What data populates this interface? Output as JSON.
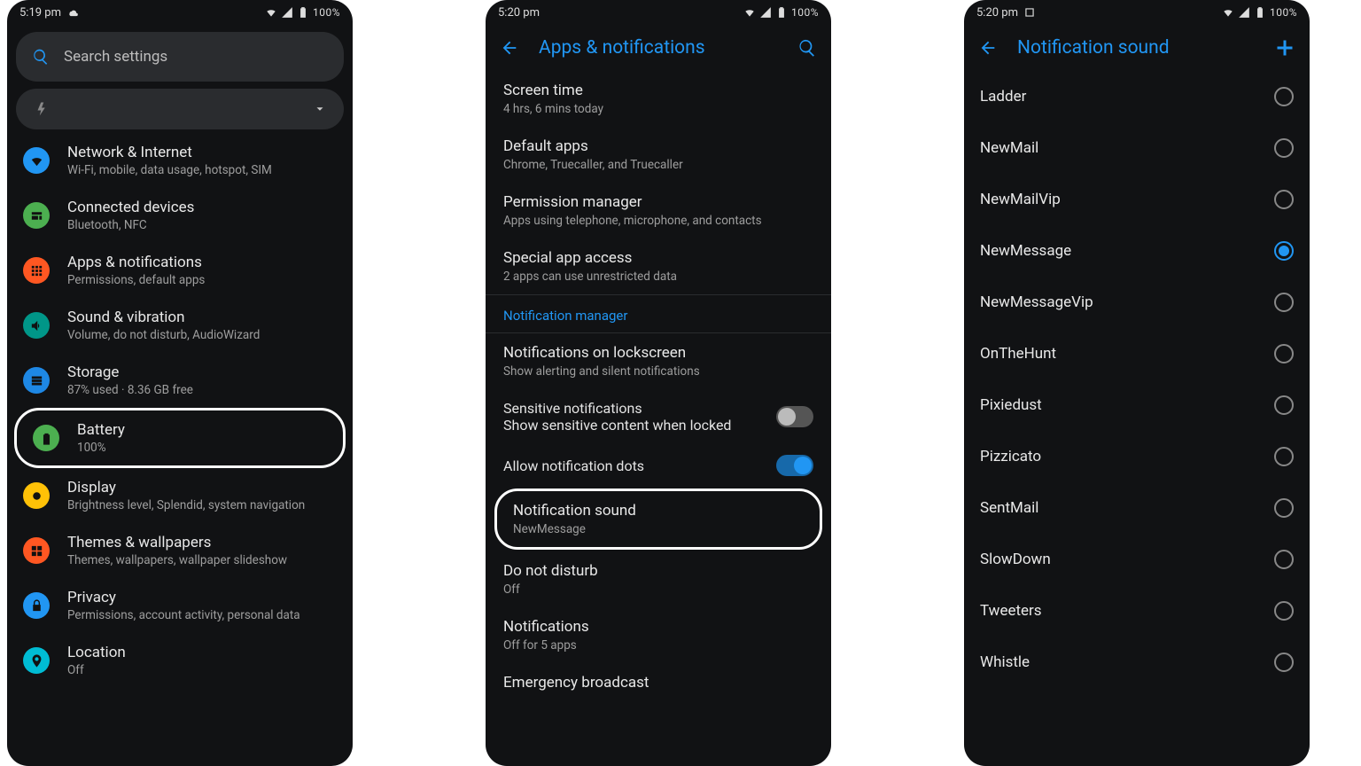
{
  "phone1": {
    "status_time": "5:19 pm",
    "battery_pct": "100%",
    "search_placeholder": "Search settings",
    "items": [
      {
        "title": "Network & Internet",
        "sub": "Wi-Fi, mobile, data usage, hotspot, SIM",
        "color": "#2196f3",
        "icon": "wifi"
      },
      {
        "title": "Connected devices",
        "sub": "Bluetooth, NFC",
        "color": "#4caf50",
        "icon": "devices"
      },
      {
        "title": "Apps & notifications",
        "sub": "Permissions, default apps",
        "color": "#ff5722",
        "icon": "apps"
      },
      {
        "title": "Sound & vibration",
        "sub": "Volume, do not disturb, AudioWizard",
        "color": "#009688",
        "icon": "volume"
      },
      {
        "title": "Storage",
        "sub": "87% used · 8.36 GB free",
        "color": "#1e88e5",
        "icon": "storage"
      },
      {
        "title": "Battery",
        "sub": "100%",
        "color": "#4caf50",
        "icon": "battery",
        "highlighted": true
      },
      {
        "title": "Display",
        "sub": "Brightness level, Splendid, system navigation",
        "color": "#ffc107",
        "icon": "display"
      },
      {
        "title": "Themes & wallpapers",
        "sub": "Themes, wallpapers, wallpaper slideshow",
        "color": "#ff5722",
        "icon": "themes"
      },
      {
        "title": "Privacy",
        "sub": "Permissions, account activity, personal data",
        "color": "#2196f3",
        "icon": "privacy"
      },
      {
        "title": "Location",
        "sub": "Off",
        "color": "#00bcd4",
        "icon": "location"
      }
    ]
  },
  "phone2": {
    "status_time": "5:20 pm",
    "battery_pct": "100%",
    "header_title": "Apps & notifications",
    "items": [
      {
        "title": "Screen time",
        "sub": "4 hrs, 6 mins today"
      },
      {
        "title": "Default apps",
        "sub": "Chrome, Truecaller, and Truecaller"
      },
      {
        "title": "Permission manager",
        "sub": "Apps using telephone, microphone, and contacts"
      },
      {
        "title": "Special app access",
        "sub": "2 apps can use unrestricted data"
      }
    ],
    "section_link": "Notification manager",
    "lockscreen": {
      "title": "Notifications on lockscreen",
      "sub": "Show alerting and silent notifications"
    },
    "sensitive": {
      "title": "Sensitive notifications",
      "sub": "Show sensitive content when locked"
    },
    "dots": {
      "title": "Allow notification dots"
    },
    "notif_sound": {
      "title": "Notification sound",
      "sub": "NewMessage"
    },
    "dnd": {
      "title": "Do not disturb",
      "sub": "Off"
    },
    "notifs": {
      "title": "Notifications",
      "sub": "Off for 5 apps"
    },
    "emergency": {
      "title": "Emergency broadcast"
    }
  },
  "phone3": {
    "status_time": "5:20 pm",
    "battery_pct": "100%",
    "header_title": "Notification sound",
    "sounds": [
      {
        "name": "Ladder",
        "selected": false
      },
      {
        "name": "NewMail",
        "selected": false
      },
      {
        "name": "NewMailVip",
        "selected": false
      },
      {
        "name": "NewMessage",
        "selected": true
      },
      {
        "name": "NewMessageVip",
        "selected": false
      },
      {
        "name": "OnTheHunt",
        "selected": false
      },
      {
        "name": "Pixiedust",
        "selected": false
      },
      {
        "name": "Pizzicato",
        "selected": false
      },
      {
        "name": "SentMail",
        "selected": false
      },
      {
        "name": "SlowDown",
        "selected": false
      },
      {
        "name": "Tweeters",
        "selected": false
      },
      {
        "name": "Whistle",
        "selected": false
      }
    ]
  }
}
